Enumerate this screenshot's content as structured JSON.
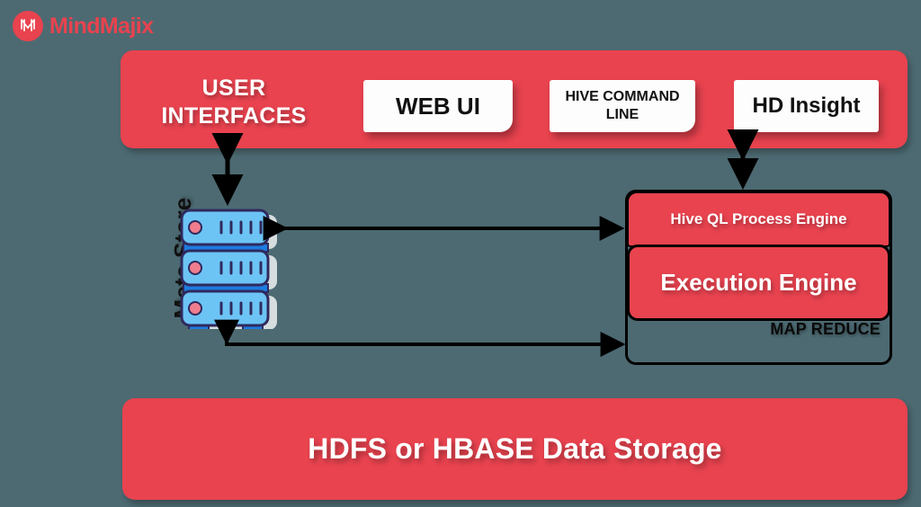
{
  "brand": {
    "name": "MindMajix",
    "logo_icon": "mindmajix-m-monogram-icon",
    "accent_color": "#e8434f"
  },
  "colors": {
    "background": "#4d6a72",
    "panel_red": "#e8434f",
    "card_white": "#fdfdfd",
    "outline_black": "#000000",
    "server_light_blue": "#6cc4f5",
    "server_dark_blue": "#1e7be0",
    "server_outline": "#2f2a5e",
    "server_led_pink": "#ef7d8e"
  },
  "user_interfaces": {
    "title": "USER\nINTERFACES",
    "title_line1": "USER",
    "title_line2": "INTERFACES",
    "cards": [
      {
        "label": "WEB UI"
      },
      {
        "label": "HIVE COMMAND LINE",
        "line1": "HIVE COMMAND",
        "line2": "LINE"
      },
      {
        "label": "HD Insight"
      }
    ]
  },
  "meta_store": {
    "label": "Meta Store",
    "icon": "server-stack-icon",
    "tiers": 3
  },
  "processing": {
    "outer_label": "MAP REDUCE",
    "hive_ql_label": "Hive QL Process Engine",
    "execution_engine_label": "Execution Engine"
  },
  "storage": {
    "label": "HDFS or HBASE Data Storage"
  },
  "arrows": [
    {
      "name": "ui-to-metastore",
      "type": "double-vertical"
    },
    {
      "name": "ui-to-mapreduce",
      "type": "double-vertical"
    },
    {
      "name": "metastore-to-hiveql",
      "type": "double-horizontal"
    },
    {
      "name": "mapreduce-to-metastore",
      "type": "elbow"
    }
  ]
}
